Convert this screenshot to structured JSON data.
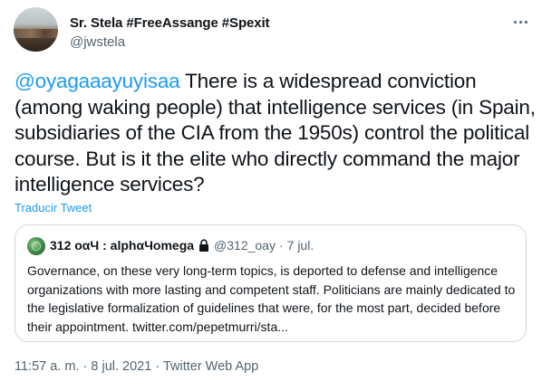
{
  "tweet": {
    "author_name": "Sr. Stela #FreeAssange #Spexit",
    "author_handle": "@jwstela",
    "mention": "@oyagaaayuyisaa",
    "body": " There is a widespread conviction (among waking people) that intelligence services (in Spain, subsidiaries of the CIA from the 1950s) control the political course. But is it the elite who directly command the major intelligence services?",
    "translate_label": "Traducir Tweet",
    "time": "11:57 a. m.",
    "date": "8 jul. 2021",
    "source": "Twitter Web App",
    "separator": "·"
  },
  "quote": {
    "name": "312 οαЧ : alphαЧomega",
    "handle": "@312_oay",
    "separator": "·",
    "date": "7 jul.",
    "text": "Governance, on these very long-term topics, is deported to defense and intelligence organizations with more lasting and competent staff. Politicians are mainly dedicated to the legislative formalization of guidelines that were, for the most part, decided before their appointment. twitter.com/pepetmurri/sta..."
  },
  "icons": {
    "more": "more-horizontal-icon",
    "lock": "lock-icon"
  },
  "colors": {
    "link": "#1d9bf0",
    "secondary": "#536471",
    "text": "#0f1419",
    "border": "#cfd9de"
  }
}
